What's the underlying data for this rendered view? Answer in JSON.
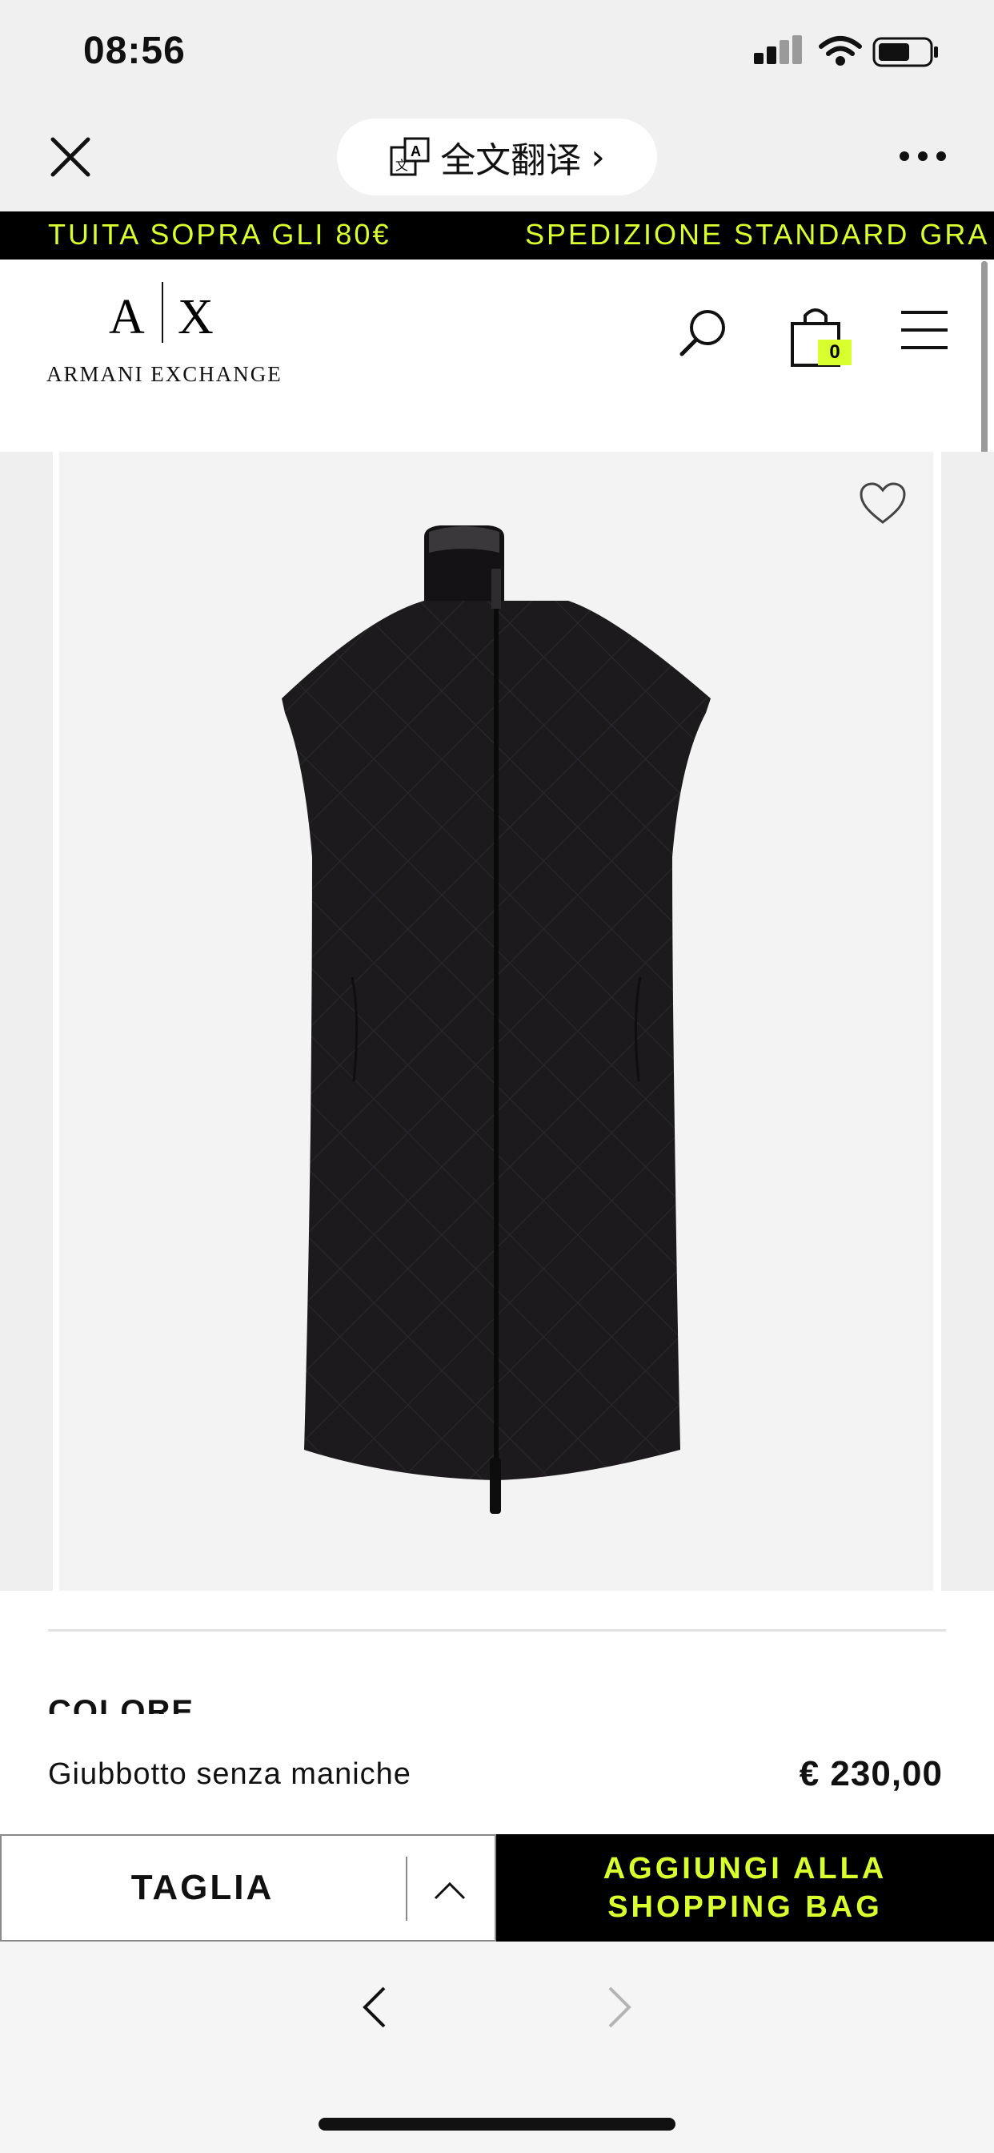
{
  "status_bar": {
    "time": "08:56"
  },
  "browser": {
    "translate_label": "全文翻译",
    "translate_chevron": "›"
  },
  "promo": {
    "left_text": "TUITA SOPRA GLI 80€",
    "right_text": "SPEDIZIONE STANDARD GRA"
  },
  "header": {
    "logo_mark": "A|X",
    "logo_text": "ARMANI EXCHANGE",
    "bag_count": "0"
  },
  "product": {
    "color_label": "COLORE",
    "name": "Giubbotto senza maniche",
    "price": "€ 230,00"
  },
  "actions": {
    "size_label": "TAGLIA",
    "add_line1": "AGGIUNGI ALLA",
    "add_line2": "SHOPPING BAG"
  },
  "colors": {
    "accent": "#d8ff2e",
    "black": "#000000",
    "product": "#1c1a1d"
  }
}
